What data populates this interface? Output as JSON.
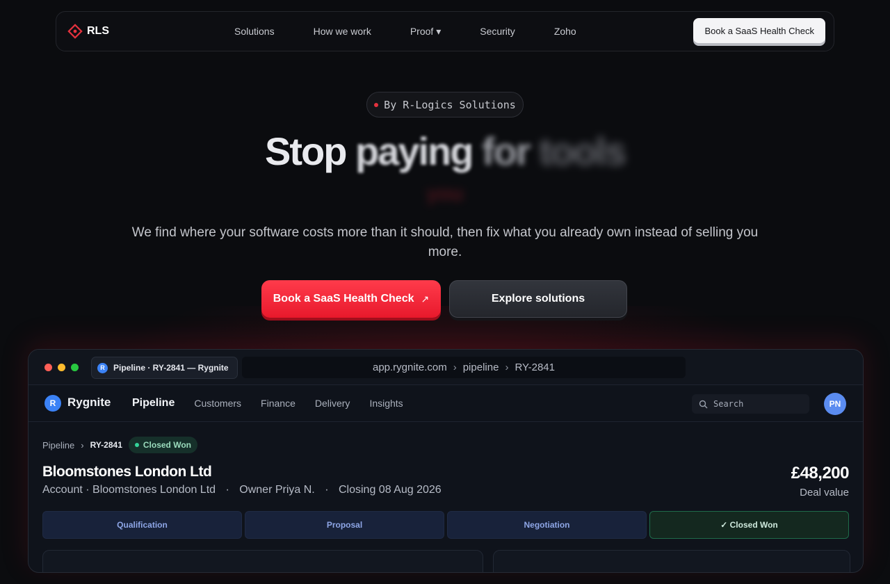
{
  "nav": {
    "brand": "RLS",
    "links": [
      "Solutions",
      "How we work",
      "Proof ▾",
      "Security",
      "Zoho"
    ],
    "cta": "Book a SaaS Health Check"
  },
  "hero": {
    "pill": "By R-Logics Solutions",
    "headline_words": [
      "Stop",
      "paying",
      "for",
      "tools"
    ],
    "headline_line2": "you",
    "subcopy": "We find where your software costs more than it should, then fix what you already own instead of selling you more.",
    "cta_primary": "Book a SaaS Health Check",
    "cta_primary_arrow": "↗",
    "cta_secondary": "Explore solutions"
  },
  "app_window": {
    "tab_icon": "R",
    "tab_title": "Pipeline · RY-2841 — Rygnite",
    "url_parts": [
      "app.rygnite.com",
      "pipeline",
      "RY-2841"
    ],
    "url_separator": "›",
    "app": {
      "logo": "R",
      "name": "Rygnite",
      "nav": [
        "Pipeline",
        "Customers",
        "Finance",
        "Delivery",
        "Insights"
      ],
      "search_placeholder": "Search",
      "avatar": "PN"
    },
    "breadcrumb": {
      "parent": "Pipeline",
      "separator": "›",
      "current": "RY-2841"
    },
    "status": "Closed Won",
    "deal": {
      "title": "Bloomstones London Ltd",
      "meta": [
        "Account · Bloomstones London Ltd",
        "Owner Priya N.",
        "Closing 08 Aug 2026"
      ],
      "meta_separator": "·",
      "value": "£48,200",
      "value_label": "Deal value"
    },
    "stages": [
      "Qualification",
      "Proposal",
      "Negotiation",
      "✓ Closed Won"
    ]
  },
  "colors": {
    "background": "#0b0c0f",
    "accent_red": "#e8192c",
    "app_blue": "#3b82f6",
    "success_green": "#34d399"
  }
}
